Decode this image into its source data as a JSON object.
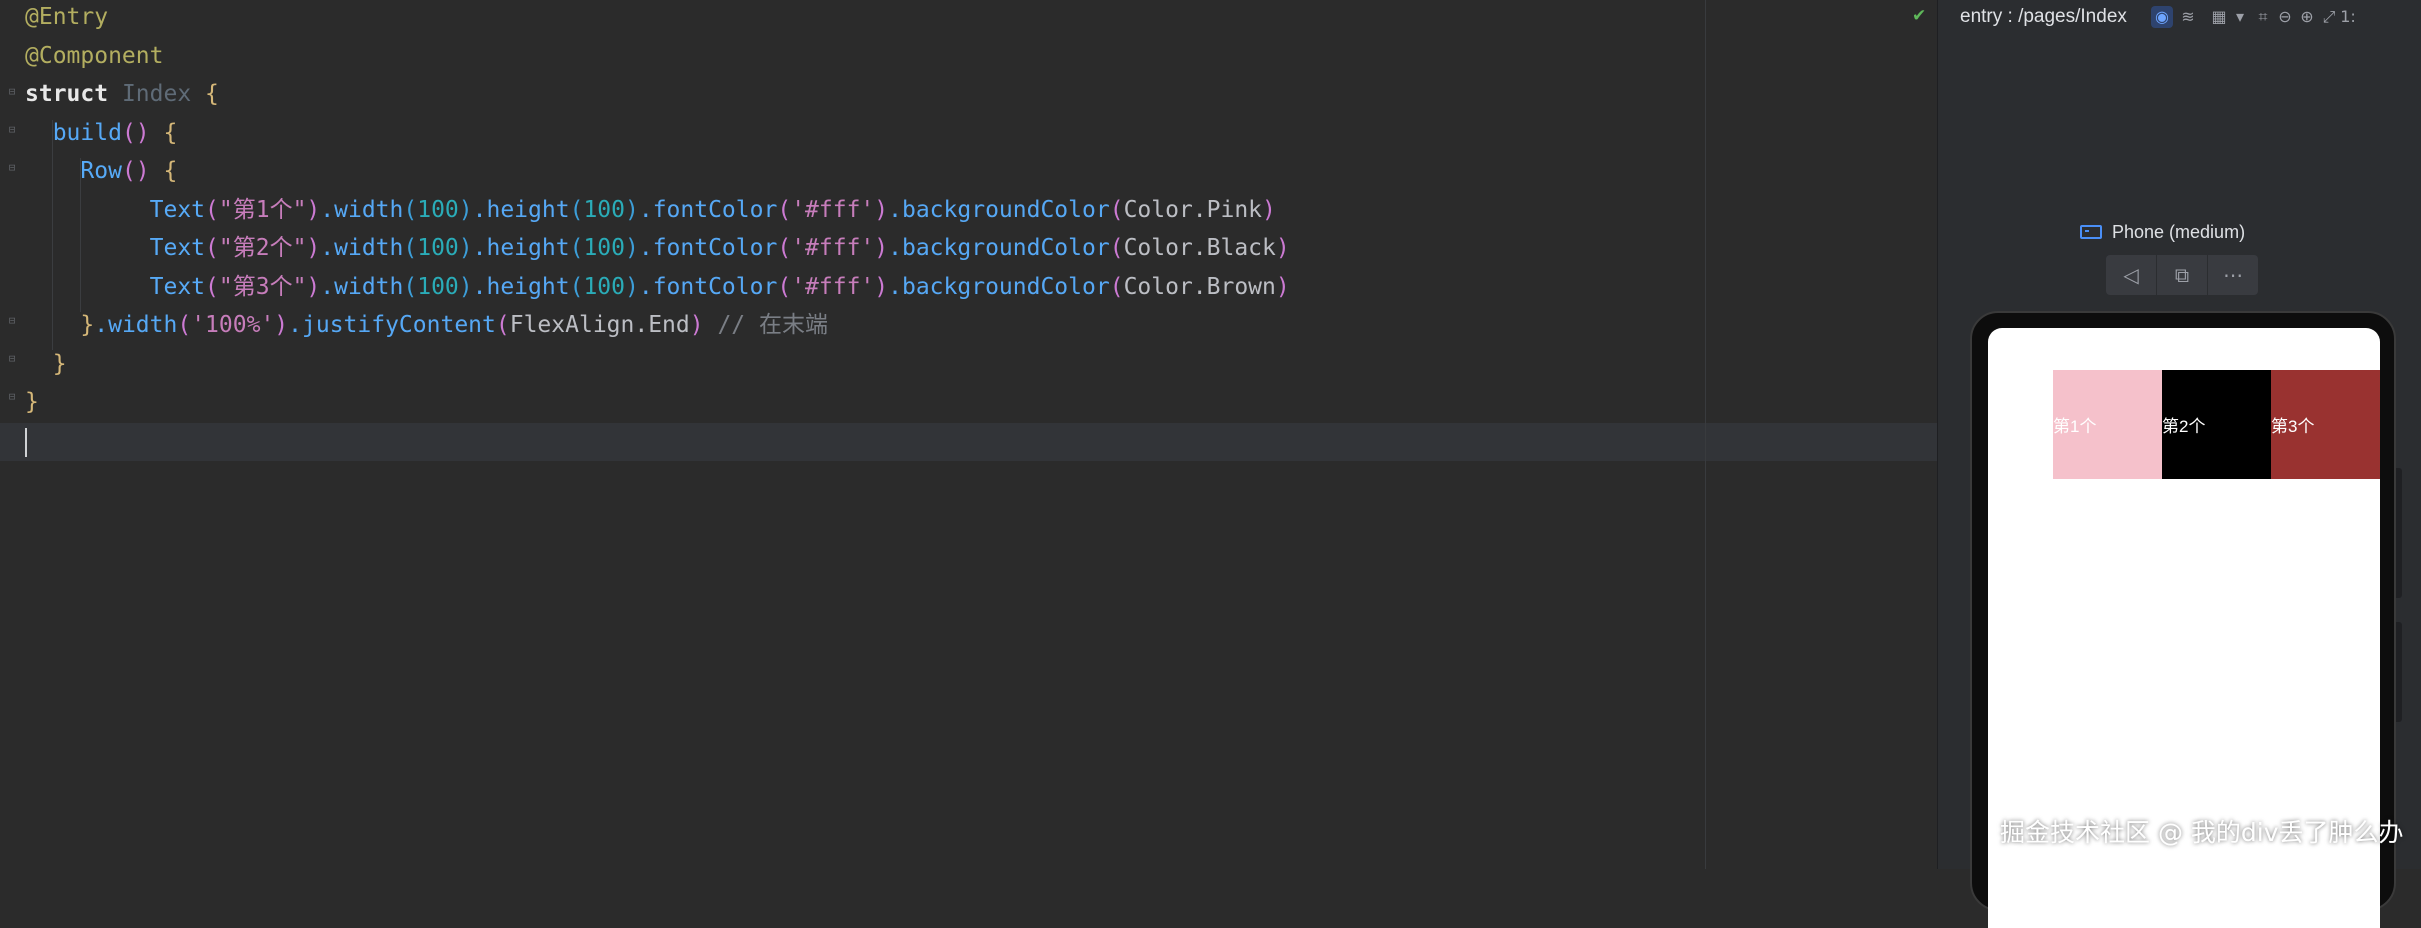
{
  "editor": {
    "lines": [
      {
        "parts": [
          {
            "t": "@Entry",
            "c": "ann"
          }
        ]
      },
      {
        "parts": [
          {
            "t": "@Component",
            "c": "ann"
          }
        ]
      },
      {
        "parts": [
          {
            "t": "struct",
            "c": "kw2"
          },
          {
            "t": " ",
            "c": ""
          },
          {
            "t": "Index",
            "c": "tyd"
          },
          {
            "t": " {",
            "c": "p1"
          }
        ]
      },
      {
        "parts": [
          {
            "t": "  ",
            "c": ""
          },
          {
            "t": "build",
            "c": "fn"
          },
          {
            "t": "()",
            "c": "p2"
          },
          {
            "t": " {",
            "c": "p1"
          }
        ]
      },
      {
        "parts": [
          {
            "t": "    ",
            "c": ""
          },
          {
            "t": "Row",
            "c": "comp"
          },
          {
            "t": "()",
            "c": "p2"
          },
          {
            "t": " {",
            "c": "p1"
          }
        ]
      },
      {
        "parts": [
          {
            "t": "         ",
            "c": ""
          },
          {
            "t": "Text",
            "c": "comp"
          },
          {
            "t": "(",
            "c": "p2"
          },
          {
            "t": "\"第1个\"",
            "c": "strp"
          },
          {
            "t": ")",
            "c": "p2"
          },
          {
            "t": ".width",
            "c": "fn"
          },
          {
            "t": "(",
            "c": "p3"
          },
          {
            "t": "100",
            "c": "num"
          },
          {
            "t": ")",
            "c": "p3"
          },
          {
            "t": ".height",
            "c": "fn"
          },
          {
            "t": "(",
            "c": "p3"
          },
          {
            "t": "100",
            "c": "num"
          },
          {
            "t": ")",
            "c": "p3"
          },
          {
            "t": ".fontColor",
            "c": "fn"
          },
          {
            "t": "(",
            "c": "p2"
          },
          {
            "t": "'#fff'",
            "c": "strp"
          },
          {
            "t": ")",
            "c": "p2"
          },
          {
            "t": ".backgroundColor",
            "c": "fn"
          },
          {
            "t": "(",
            "c": "p2"
          },
          {
            "t": "Color.Pink",
            "c": ""
          },
          {
            "t": ")",
            "c": "p2"
          }
        ]
      },
      {
        "parts": [
          {
            "t": "         ",
            "c": ""
          },
          {
            "t": "Text",
            "c": "comp"
          },
          {
            "t": "(",
            "c": "p2"
          },
          {
            "t": "\"第2个\"",
            "c": "strp"
          },
          {
            "t": ")",
            "c": "p2"
          },
          {
            "t": ".width",
            "c": "fn"
          },
          {
            "t": "(",
            "c": "p3"
          },
          {
            "t": "100",
            "c": "num"
          },
          {
            "t": ")",
            "c": "p3"
          },
          {
            "t": ".height",
            "c": "fn"
          },
          {
            "t": "(",
            "c": "p3"
          },
          {
            "t": "100",
            "c": "num"
          },
          {
            "t": ")",
            "c": "p3"
          },
          {
            "t": ".fontColor",
            "c": "fn"
          },
          {
            "t": "(",
            "c": "p2"
          },
          {
            "t": "'#fff'",
            "c": "strp"
          },
          {
            "t": ")",
            "c": "p2"
          },
          {
            "t": ".backgroundColor",
            "c": "fn"
          },
          {
            "t": "(",
            "c": "p2"
          },
          {
            "t": "Color.Black",
            "c": ""
          },
          {
            "t": ")",
            "c": "p2"
          }
        ]
      },
      {
        "parts": [
          {
            "t": "         ",
            "c": ""
          },
          {
            "t": "Text",
            "c": "comp"
          },
          {
            "t": "(",
            "c": "p2"
          },
          {
            "t": "\"第3个\"",
            "c": "strp"
          },
          {
            "t": ")",
            "c": "p2"
          },
          {
            "t": ".width",
            "c": "fn"
          },
          {
            "t": "(",
            "c": "p3"
          },
          {
            "t": "100",
            "c": "num"
          },
          {
            "t": ")",
            "c": "p3"
          },
          {
            "t": ".height",
            "c": "fn"
          },
          {
            "t": "(",
            "c": "p3"
          },
          {
            "t": "100",
            "c": "num"
          },
          {
            "t": ")",
            "c": "p3"
          },
          {
            "t": ".fontColor",
            "c": "fn"
          },
          {
            "t": "(",
            "c": "p2"
          },
          {
            "t": "'#fff'",
            "c": "strp"
          },
          {
            "t": ")",
            "c": "p2"
          },
          {
            "t": ".backgroundColor",
            "c": "fn"
          },
          {
            "t": "(",
            "c": "p2"
          },
          {
            "t": "Color.Brown",
            "c": ""
          },
          {
            "t": ")",
            "c": "p2"
          }
        ]
      },
      {
        "parts": [
          {
            "t": "    ",
            "c": ""
          },
          {
            "t": "}",
            "c": "p1"
          },
          {
            "t": ".width",
            "c": "fn"
          },
          {
            "t": "(",
            "c": "p2"
          },
          {
            "t": "'100%'",
            "c": "strp"
          },
          {
            "t": ")",
            "c": "p2"
          },
          {
            "t": ".justifyContent",
            "c": "fn"
          },
          {
            "t": "(",
            "c": "p2"
          },
          {
            "t": "FlexAlign.End",
            "c": ""
          },
          {
            "t": ")",
            "c": "p2"
          },
          {
            "t": " // 在末端",
            "c": "cm"
          }
        ]
      },
      {
        "parts": [
          {
            "t": "  ",
            "c": ""
          },
          {
            "t": "}",
            "c": "p1"
          }
        ]
      },
      {
        "parts": [
          {
            "t": "}",
            "c": "p1"
          }
        ]
      },
      {
        "parts": [
          {
            "t": "",
            "c": ""
          }
        ]
      }
    ]
  },
  "previewer": {
    "route": "entry : /pages/Index",
    "device": "Phone (medium)",
    "toolbar_icons": [
      "eye-icon",
      "layers-icon",
      "grid-icon",
      "dropdown-icon",
      "crop-icon",
      "zoom-out-icon",
      "zoom-in-icon",
      "fit-icon"
    ],
    "toolbar_trailing": "1:",
    "controls": [
      "back-icon",
      "rotate-icon",
      "more-icon"
    ],
    "preview_cells": [
      {
        "label": "第1个",
        "color": "#f5c1cb"
      },
      {
        "label": "第2个",
        "color": "#000000"
      },
      {
        "label": "第3个",
        "color": "#993230"
      }
    ]
  },
  "watermark": "掘金技术社区 @ 我的div丢了肿么办",
  "colors": {
    "editor_bg": "#2b2b2b",
    "panel_bg": "#2b2d30",
    "accent": "#4a8ff7"
  }
}
